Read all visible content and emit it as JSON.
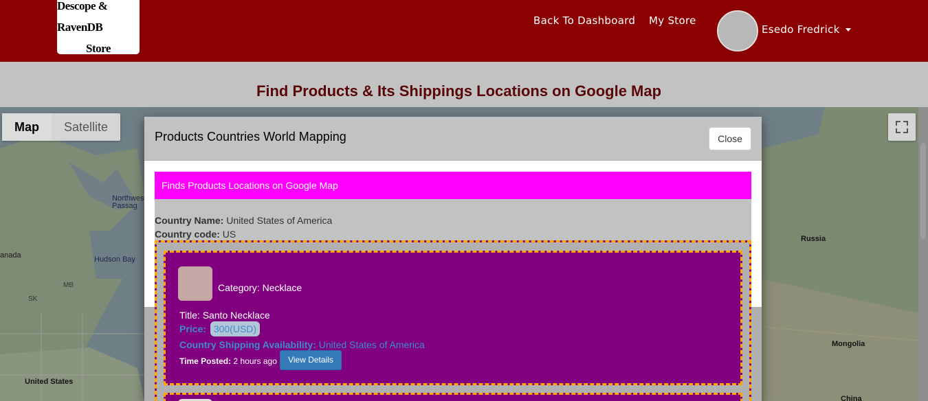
{
  "navbar": {
    "logo_line1": "Descope & RavenDB",
    "logo_line2": "Store",
    "back_label": "Back To Dashboard",
    "store_label": "My Store",
    "user_name": "Esedo Fredrick"
  },
  "page": {
    "title": "Find Products & Its Shippings Locations on Google Map"
  },
  "map": {
    "type_map": "Map",
    "type_satellite": "Satellite",
    "labels": {
      "northwest_passages": "Northwest\nPassages",
      "hudson_bay": "Hudson Bay",
      "anada": "anada",
      "mb": "MB",
      "sk": "SK",
      "united_states": "United States",
      "russia": "Russia",
      "mongolia": "Mongolia",
      "china": "China"
    }
  },
  "modal": {
    "title": "Products Countries World Mapping",
    "close_label": "Close",
    "banner": "Finds Products Locations on Google Map",
    "country_name_label": "Country Name:",
    "country_name_value": "United States of America",
    "country_code_label": "Country code:",
    "country_code_value": "US"
  },
  "product": {
    "category_text": "Category: Necklace",
    "title_text": "Title: Santo Necklace",
    "price_label": "Price:",
    "price_value": "300(USD)",
    "shipping_label": "Country Shipping Availability:",
    "shipping_value": "United States of America",
    "time_label": "Time Posted:",
    "time_value": "2 hours ago",
    "view_button": "View Details"
  },
  "colors": {
    "navbar": "#8b0000",
    "banner": "#ff00ff",
    "card": "#800080",
    "card_border": "#ffa500",
    "button": "#337ab7"
  }
}
